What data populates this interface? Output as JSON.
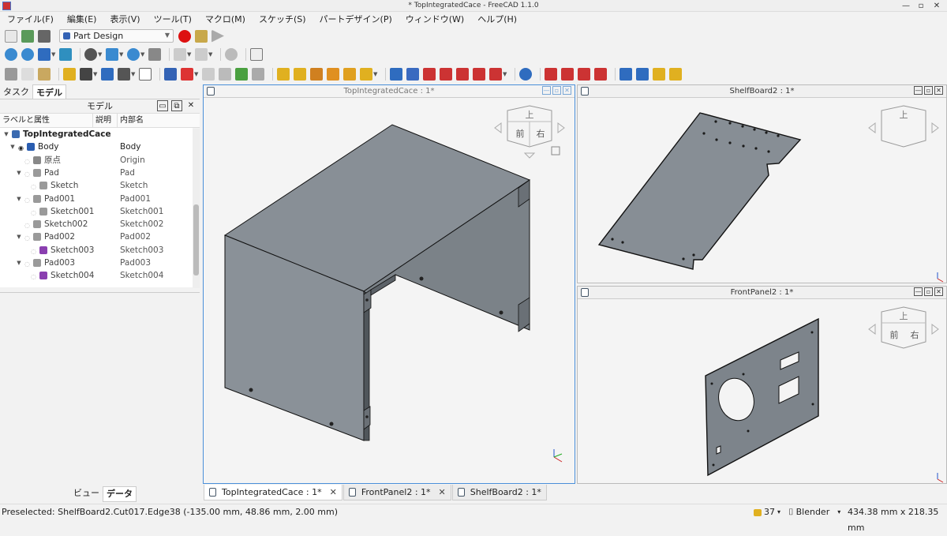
{
  "window": {
    "title": "* TopIntegratedCace - FreeCAD 1.1.0"
  },
  "menu": [
    "ファイル(F)",
    "編集(E)",
    "表示(V)",
    "ツール(T)",
    "マクロ(M)",
    "スケッチ(S)",
    "パートデザイン(P)",
    "ウィンドウ(W)",
    "ヘルプ(H)"
  ],
  "toolbar": {
    "workbench": "Part Design"
  },
  "left_panel": {
    "tabs": [
      "タスク",
      "モデル"
    ],
    "header": "モデル",
    "columns": [
      "ラベルと属性",
      "説明",
      "内部名"
    ],
    "tree": [
      {
        "label": "TopIntegratedCace",
        "internal": "",
        "depth": 0,
        "bold": true,
        "icon": "document-icon",
        "color": "#3a6ab0"
      },
      {
        "label": "Body",
        "internal": "Body",
        "depth": 1,
        "icon": "body-icon",
        "color": "#2a5db0"
      },
      {
        "label": "原点",
        "internal": "Origin",
        "depth": 2,
        "icon": "origin-icon",
        "color": "#888888"
      },
      {
        "label": "Pad",
        "internal": "Pad",
        "depth": 2,
        "icon": "pad-icon",
        "color": "#9a9a9a"
      },
      {
        "label": "Sketch",
        "internal": "Sketch",
        "depth": 3,
        "icon": "sketch-icon",
        "color": "#9a9a9a"
      },
      {
        "label": "Pad001",
        "internal": "Pad001",
        "depth": 2,
        "icon": "pad-icon",
        "color": "#9a9a9a"
      },
      {
        "label": "Sketch001",
        "internal": "Sketch001",
        "depth": 3,
        "icon": "sketch-icon",
        "color": "#9a9a9a"
      },
      {
        "label": "Sketch002",
        "internal": "Sketch002",
        "depth": 2,
        "icon": "sketch-icon",
        "color": "#9a9a9a"
      },
      {
        "label": "Pad002",
        "internal": "Pad002",
        "depth": 2,
        "icon": "pad-icon",
        "color": "#9a9a9a"
      },
      {
        "label": "Sketch003",
        "internal": "Sketch003",
        "depth": 3,
        "icon": "sketch-icon",
        "color": "#8a3fb0"
      },
      {
        "label": "Pad003",
        "internal": "Pad003",
        "depth": 2,
        "icon": "pad-icon",
        "color": "#9a9a9a"
      },
      {
        "label": "Sketch004",
        "internal": "Sketch004",
        "depth": 3,
        "icon": "sketch-icon",
        "color": "#8a3fb0"
      }
    ],
    "bottom_tabs": [
      "ビュー",
      "データ"
    ]
  },
  "views": {
    "main": {
      "title": "TopIntegratedCace : 1*"
    },
    "shelf": {
      "title": "ShelfBoard2 : 1*"
    },
    "front": {
      "title": "FrontPanel2 : 1*"
    }
  },
  "navcube": {
    "top": "上",
    "front": "前",
    "right": "右"
  },
  "doc_tabs": [
    "TopIntegratedCace : 1*",
    "FrontPanel2 : 1*",
    "ShelfBoard2 : 1*"
  ],
  "status": {
    "message": "Preselected: ShelfBoard2.Cut017.Edge38 (-135.00 mm, 48.86 mm, 2.00 mm)",
    "count": "37",
    "nav_style": "Blender",
    "dimensions": "434.38 mm x 218.35 mm"
  }
}
